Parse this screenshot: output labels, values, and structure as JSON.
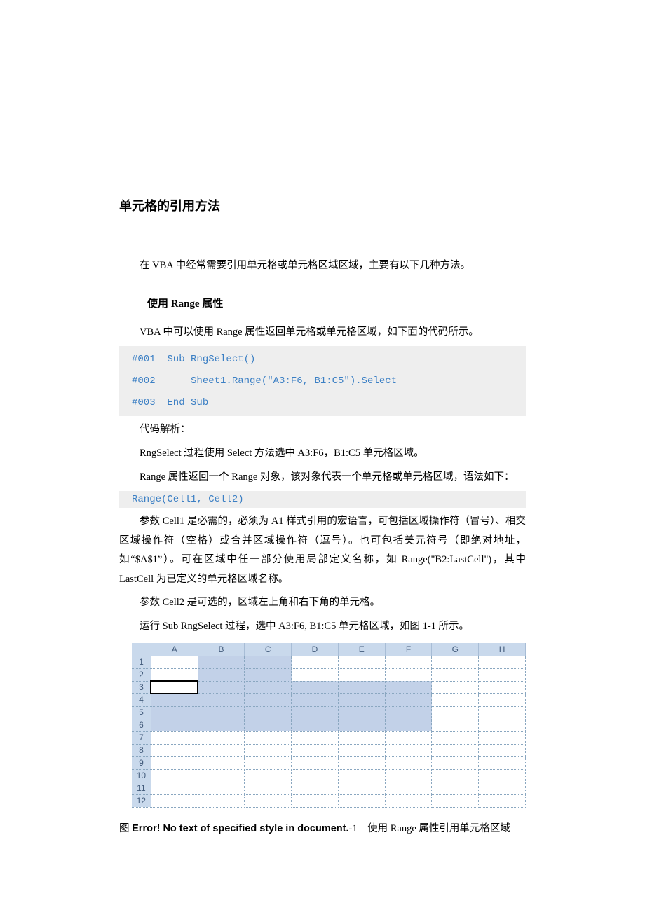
{
  "title": "单元格的引用方法",
  "intro": "在 VBA 中经常需要引用单元格或单元格区域区域，主要有以下几种方法。",
  "section1": {
    "heading": "使用 Range 属性",
    "lead": "VBA 中可以使用 Range 属性返回单元格或单元格区域，如下面的代码所示。",
    "code": "#001  Sub RngSelect()\n#002      Sheet1.Range(\"A3:F6, B1:C5\").Select\n#003  End Sub",
    "desc_label": "代码解析：",
    "desc1": "RngSelect 过程使用 Select 方法选中 A3:F6，B1:C5 单元格区域。",
    "desc2": "Range 属性返回一个 Range 对象，该对象代表一个单元格或单元格区域，语法如下：",
    "syntax": "Range(Cell1, Cell2)",
    "para_cell1": "参数 Cell1 是必需的，必须为 A1 样式引用的宏语言，可包括区域操作符（冒号）、相交区域操作符（空格）或合并区域操作符（逗号）。也可包括美元符号（即绝对地址，如“$A$1”）。可在区域中任一部分使用局部定义名称，如 Range(\"B2:LastCell\")，其中 LastCell 为已定义的单元格区域名称。",
    "para_cell2": "参数 Cell2 是可选的，区域左上角和右下角的单元格。",
    "para_run": "运行 Sub RngSelect 过程，选中 A3:F6, B1:C5 单元格区域，如图 1-1 所示。"
  },
  "excel": {
    "columns": [
      "A",
      "B",
      "C",
      "D",
      "E",
      "F",
      "G",
      "H"
    ],
    "rows": [
      "1",
      "2",
      "3",
      "4",
      "5",
      "6",
      "7",
      "8",
      "9",
      "10",
      "11",
      "12"
    ],
    "selected_cells": [
      "B1",
      "C1",
      "B2",
      "C2",
      "A3",
      "B3",
      "C3",
      "D3",
      "E3",
      "F3",
      "A4",
      "B4",
      "C4",
      "D4",
      "E4",
      "F4",
      "A5",
      "B5",
      "C5",
      "D5",
      "E5",
      "F5",
      "A6",
      "B6",
      "C6",
      "D6",
      "E6",
      "F6"
    ],
    "active_cell": "A3"
  },
  "figure_caption": {
    "prefix": "图 ",
    "error_bold": "Error! No text of specified style in document.",
    "suffix_num": "-1",
    "gap": " ",
    "text": "使用 Range 属性引用单元格区域"
  }
}
